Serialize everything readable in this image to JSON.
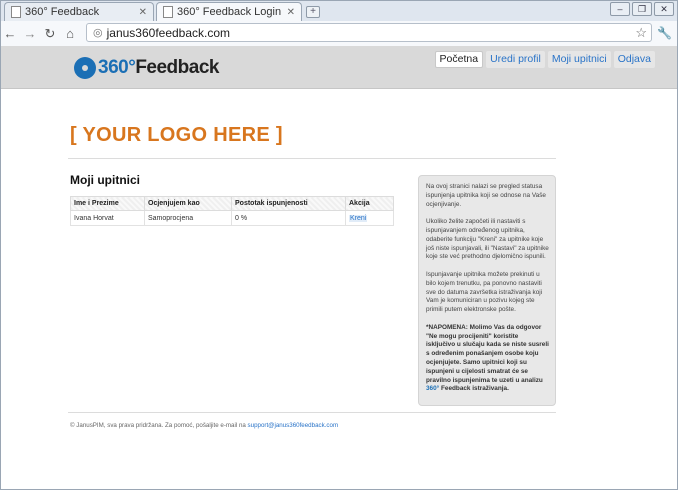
{
  "browser": {
    "tabs": [
      {
        "title": "360° Feedback",
        "active": false
      },
      {
        "title": "360° Feedback Login",
        "active": true
      }
    ],
    "url": "janus360feedback.com"
  },
  "header": {
    "logo_360": "360°",
    "logo_feedback": "Feedback",
    "nav": [
      {
        "label": "Početna",
        "current": true
      },
      {
        "label": "Uredi profil",
        "current": false
      },
      {
        "label": "Moji upitnici",
        "current": false
      },
      {
        "label": "Odjava",
        "current": false
      }
    ]
  },
  "main": {
    "placeholder_logo": "[ YOUR LOGO HERE ]",
    "section_title": "Moji upitnici",
    "table": {
      "columns": [
        "Ime i Prezime",
        "Ocjenjujem kao",
        "Postotak ispunjenosti",
        "Akcija"
      ],
      "rows": [
        {
          "name": "Ivana Horvat",
          "role": "Samoprocjena",
          "percent": "0 %",
          "action": "Kreni"
        }
      ]
    }
  },
  "sidebar": {
    "p1": "Na ovoj stranici nalazi se pregled statusa ispunjenja upitnika koji se odnose na Vaše ocjenjivanje.",
    "p2": "Ukoliko želite započeti ili nastaviti s ispunjavanjem određenog upitnika, odaberite funkciju \"Kreni\" za upitnike koje još niste ispunjavali, ili \"Nastavi\" za upitnike koje ste već prethodno djelomično ispunili.",
    "p3": "Ispunjavanje upitnika možete prekinuti u bilo kojem trenutku, pa ponovno nastaviti sve do datuma završetka istraživanja koji Vam je komuniciran u pozivu kojeg ste primili putem elektronske pošte.",
    "note_a": "*NAPOMENA: Molimo Vas da odgovor \"Ne mogu procijeniti\" koristite isključivo u slučaju kada se niste susreli s određenim ponašanjem osobe koju ocjenjujete. Samo upitnici koji su ispunjeni u cijelosti smatrat će se pravilno ispunjenima te uzeti u analizu ",
    "note_360": "360°",
    "note_b": " Feedback istraživanja."
  },
  "footer": {
    "text": "© JanusPIM, sva prava pridržana. Za pomoć, pošaljite e-mail na ",
    "email": "support@janus360feedback.com"
  }
}
